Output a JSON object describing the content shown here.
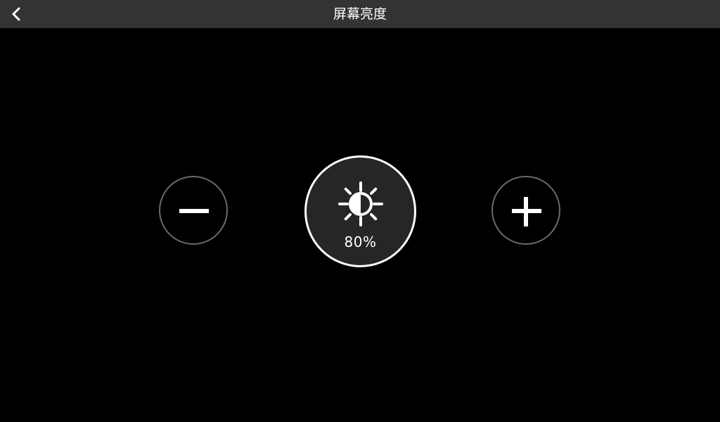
{
  "header": {
    "title": "屏幕亮度",
    "back_icon": "chevron-left-icon"
  },
  "brightness": {
    "value_text": "80%",
    "level_percent": 80,
    "icon": "brightness-sun-icon"
  },
  "controls": {
    "decrease_icon": "minus-icon",
    "increase_icon": "plus-icon"
  },
  "colors": {
    "background": "#000000",
    "header_bar": "#333333",
    "dial_fill": "#262626",
    "dial_border": "#ffffff",
    "button_border": "#6a6a6a",
    "foreground": "#ffffff"
  }
}
